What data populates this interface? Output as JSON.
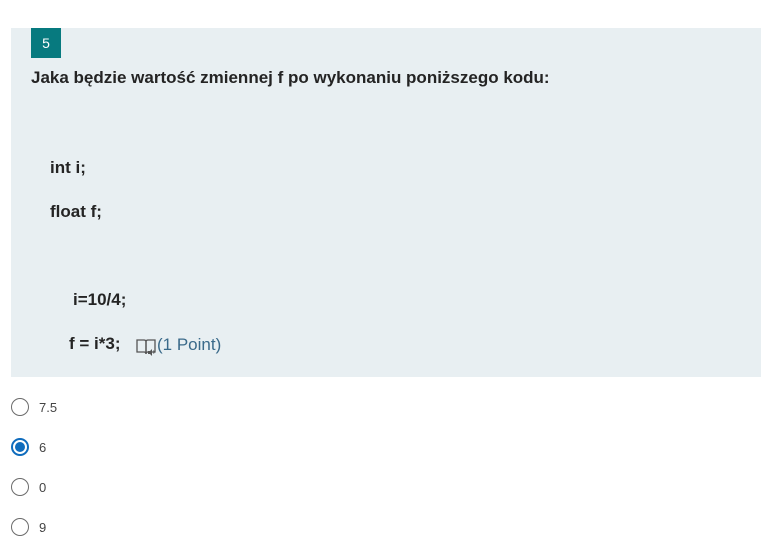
{
  "question": {
    "number": "5",
    "title": "Jaka będzie wartość zmiennej f po wykonaniu poniższego kodu:",
    "code": [
      "int i;",
      "float f;",
      "i=10/4;",
      "f = i*3;"
    ],
    "points": "(1 Point)"
  },
  "options": [
    {
      "label": "7.5",
      "selected": false
    },
    {
      "label": "6",
      "selected": true
    },
    {
      "label": "0",
      "selected": false
    },
    {
      "label": "9",
      "selected": false
    }
  ],
  "colors": {
    "accent": "#077a7f",
    "card_background": "#e8eff2",
    "radio_selected": "#0f6cbd",
    "points_text": "#3a6a8a"
  },
  "icons": {
    "reader": "immersive-reader-icon"
  }
}
